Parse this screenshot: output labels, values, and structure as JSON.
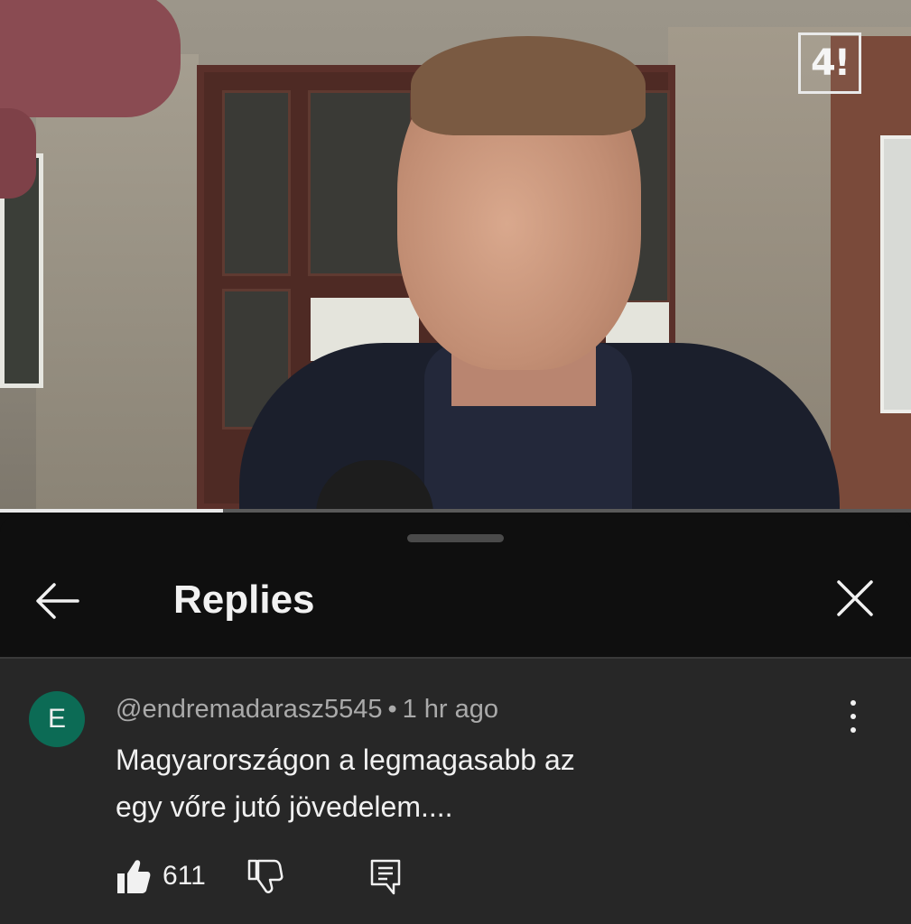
{
  "video": {
    "channel_logo_text": "4!",
    "progress_fraction": 0.245
  },
  "panel": {
    "title": "Replies"
  },
  "comment": {
    "avatar_letter": "E",
    "avatar_color": "#0c6b55",
    "author": "@endremadarasz5545",
    "separator": "•",
    "time": "1 hr ago",
    "text_line1": "Magyarországon a legmagasabb az",
    "text_line2": "egy vőre jutó jövedelem....",
    "like_count": "611"
  },
  "icons": {
    "back": "arrow-left-icon",
    "close": "close-icon",
    "more": "more-vertical-icon",
    "like": "thumbs-up-icon",
    "dislike": "thumbs-down-icon",
    "reply": "comment-icon"
  }
}
